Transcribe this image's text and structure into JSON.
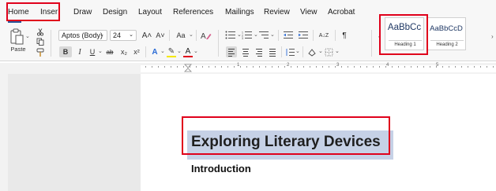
{
  "tabs": [
    "Home",
    "Insert",
    "Draw",
    "Design",
    "Layout",
    "References",
    "Mailings",
    "Review",
    "View",
    "Acrobat"
  ],
  "tab_visible_labels": [
    "Home",
    "Inser",
    "Draw",
    "Design",
    "Layout",
    "References",
    "Mailings",
    "Review",
    "View",
    "Acrobat"
  ],
  "active_tab": "Home",
  "ribbon": {
    "paste_label": "Paste",
    "font_name": "Aptos (Body)",
    "font_size": "24",
    "grow_font": "A˄",
    "shrink_font": "A˅",
    "change_case": "Aa",
    "bold": "B",
    "italic": "I",
    "underline": "U",
    "strikethrough": "ab",
    "subscript": "x₂",
    "superscript": "x²",
    "text_effects": "A",
    "highlight": "✎",
    "font_color": "A",
    "sort": "A↓Z",
    "pilcrow": "¶"
  },
  "styles": {
    "cards": [
      {
        "sample": "AaBbCc",
        "name": "Heading 1"
      },
      {
        "sample": "AaBbCcD",
        "name": "Heading 2"
      }
    ]
  },
  "ruler": {
    "numbers": [
      "1",
      "2",
      "3",
      "4",
      "5"
    ]
  },
  "document": {
    "title": "Exploring Literary Devices",
    "heading": "Introduction"
  },
  "colors": {
    "annotation": "#e0001b",
    "selection": "#c6d1e6",
    "accent": "#2b579a"
  }
}
